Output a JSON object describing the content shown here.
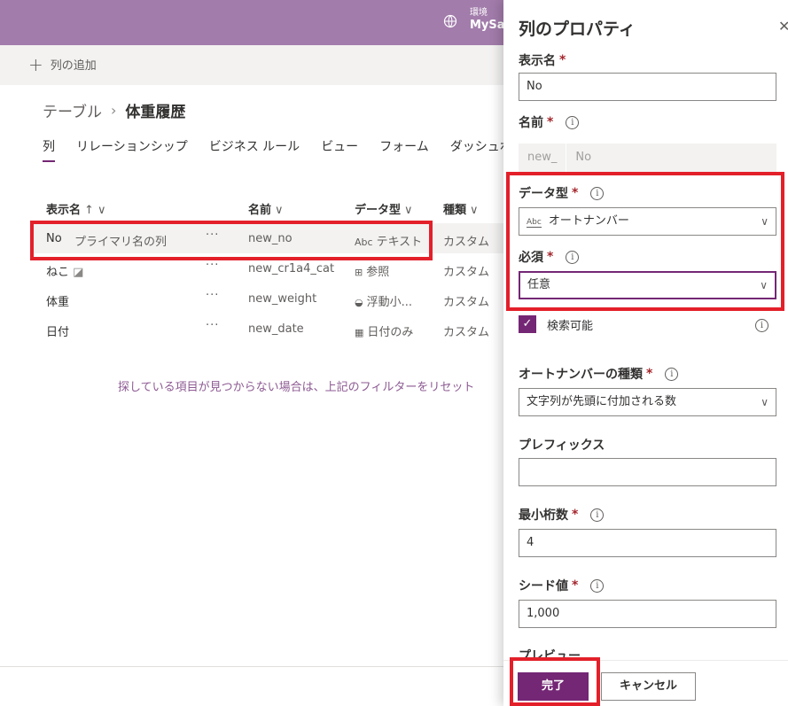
{
  "topbar": {
    "env_label": "環境",
    "env_name": "MySan"
  },
  "cmdbar": {
    "add_column": "列の追加"
  },
  "breadcrumb": {
    "root": "テーブル",
    "separator": "›",
    "current": "体重履歴"
  },
  "tabs": [
    "列",
    "リレーションシップ",
    "ビジネス ルール",
    "ビュー",
    "フォーム",
    "ダッシュボ"
  ],
  "table": {
    "headers": {
      "display_name": "表示名",
      "name": "名前",
      "data_type": "データ型",
      "type": "種類"
    },
    "rows": [
      {
        "display": "No",
        "sub": "プライマリ名の列",
        "dots": "···",
        "name": "new_no",
        "type_icon": "Abc",
        "datatype": "テキスト",
        "kind": "カスタム"
      },
      {
        "display": "ねこ",
        "sub": "",
        "dots": "···",
        "name": "new_cr1a4_cat",
        "type_icon": "⊞",
        "datatype": "参照",
        "kind": "カスタム"
      },
      {
        "display": "体重",
        "sub": "",
        "dots": "···",
        "name": "new_weight",
        "type_icon": "◒",
        "datatype": "浮動小...",
        "kind": "カスタム"
      },
      {
        "display": "日付",
        "sub": "",
        "dots": "···",
        "name": "new_date",
        "type_icon": "▦",
        "datatype": "日付のみ",
        "kind": "カスタム"
      }
    ],
    "filter_message": "探している項目が見つからない場合は、上記のフィルターをリセット"
  },
  "panel": {
    "title": "列のプロパティ",
    "display_name_label": "表示名",
    "display_name_value": "No",
    "name_label": "名前",
    "name_prefix": "new_",
    "name_value": "No",
    "data_type_label": "データ型",
    "data_type_icon": "Abc",
    "data_type_value": "オートナンバー",
    "required_label": "必須",
    "required_value": "任意",
    "searchable_label": "検索可能",
    "autonumber_type_label": "オートナンバーの種類",
    "autonumber_type_value": "文字列が先頭に付加される数",
    "prefix_label": "プレフィックス",
    "prefix_value": "",
    "min_digits_label": "最小桁数",
    "min_digits_value": "4",
    "seed_label": "シード値",
    "seed_value": "1,000",
    "preview_label": "プレビュー",
    "required_mark": "*",
    "info_glyph": "i",
    "done_button": "完了",
    "cancel_button": "キャンセル"
  },
  "colors": {
    "accent": "#742774",
    "topbar": "#a27cab",
    "highlight": "#e3202a"
  }
}
